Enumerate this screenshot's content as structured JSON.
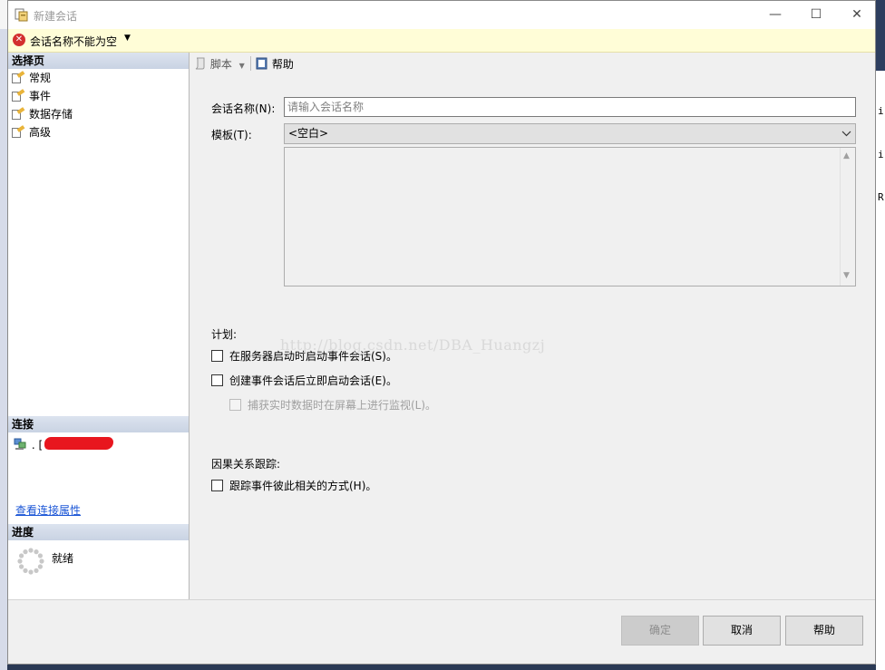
{
  "background": {
    "right_text_1": "i",
    "right_text_2": "i",
    "right_text_3": "R"
  },
  "window": {
    "title": "新建会话",
    "minimize": "—",
    "maximize": "☐",
    "close": "✕"
  },
  "error": {
    "message": "会话名称不能为空"
  },
  "left": {
    "select_page_header": "选择页",
    "pages": [
      {
        "label": "常规"
      },
      {
        "label": "事件"
      },
      {
        "label": "数据存储"
      },
      {
        "label": "高级"
      }
    ],
    "connection_header": "连接",
    "connection_server": ". [",
    "view_connection_properties": "查看连接属性",
    "progress_header": "进度",
    "progress_status": "就绪"
  },
  "toolbar": {
    "script_label": "脚本",
    "help_label": "帮助"
  },
  "form": {
    "session_name_label": "会话名称(N):",
    "session_name_placeholder": "请输入会话名称",
    "session_name_value": "",
    "template_label": "模板(T):",
    "template_value": "<空白>",
    "schedule_label": "计划:",
    "start_on_server_start": "在服务器启动时启动事件会话(S)。",
    "start_after_create": "创建事件会话后立即启动会话(E)。",
    "watch_live_data": "捕获实时数据时在屏幕上进行监视(L)。",
    "causality_label": "因果关系跟踪:",
    "track_causality": "跟踪事件彼此相关的方式(H)。"
  },
  "watermark": "http://blog.csdn.net/DBA_Huangzj",
  "buttons": {
    "ok": "确定",
    "cancel": "取消",
    "help": "帮助"
  }
}
